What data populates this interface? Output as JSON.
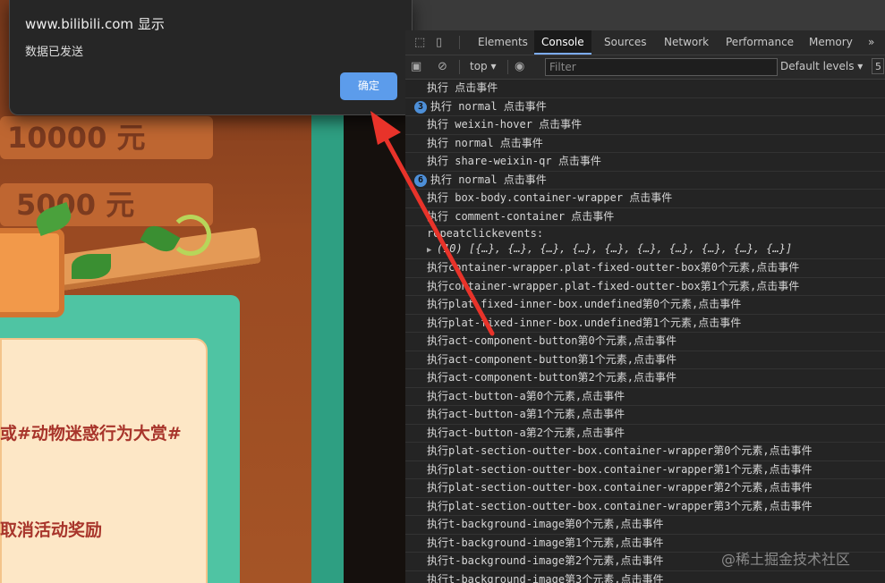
{
  "page": {
    "prizes": [
      "10000 元",
      "5000 元"
    ],
    "text_line1": "或#动物迷惑行为大赏#",
    "text_line2": "取消活动奖励"
  },
  "dialog": {
    "title": "www.bilibili.com 显示",
    "message": "数据已发送",
    "ok_label": "确定"
  },
  "devtools": {
    "tabs": [
      "Elements",
      "Console",
      "Sources",
      "Network",
      "Performance",
      "Memory"
    ],
    "active_tab": "Console",
    "more_tabs": "»",
    "context": "top ▾",
    "filter_placeholder": "Filter",
    "levels": "Default levels ▾",
    "extra": "5",
    "accent": "#7cacf8"
  },
  "console": {
    "rows": [
      {
        "count": "",
        "text": "执行      点击事件"
      },
      {
        "count": "3",
        "text": "执行 normal 点击事件"
      },
      {
        "count": "",
        "text": "执行 weixin-hover 点击事件"
      },
      {
        "count": "",
        "text": "执行 normal 点击事件"
      },
      {
        "count": "",
        "text": "执行 share-weixin-qr 点击事件"
      },
      {
        "count": "6",
        "text": "执行 normal 点击事件"
      },
      {
        "count": "",
        "text": "执行 box-body.container-wrapper 点击事件"
      },
      {
        "count": "",
        "text": "执行 comment-container 点击事件"
      }
    ],
    "object_label": "repeatclickevents:",
    "object_summary": "(10) [{…}, {…}, {…}, {…}, {…}, {…}, {…}, {…}, {…}, {…}]",
    "rows2": [
      "执行container-wrapper.plat-fixed-outter-box第0个元素,点击事件",
      "执行container-wrapper.plat-fixed-outter-box第1个元素,点击事件",
      "执行plat-fixed-inner-box.undefined第0个元素,点击事件",
      "执行plat-fixed-inner-box.undefined第1个元素,点击事件",
      "执行act-component-button第0个元素,点击事件",
      "执行act-component-button第1个元素,点击事件",
      "执行act-component-button第2个元素,点击事件",
      "执行act-button-a第0个元素,点击事件",
      "执行act-button-a第1个元素,点击事件",
      "执行act-button-a第2个元素,点击事件",
      "执行plat-section-outter-box.container-wrapper第0个元素,点击事件",
      "执行plat-section-outter-box.container-wrapper第1个元素,点击事件",
      "执行plat-section-outter-box.container-wrapper第2个元素,点击事件",
      "执行plat-section-outter-box.container-wrapper第3个元素,点击事件",
      "执行t-background-image第0个元素,点击事件",
      "执行t-background-image第1个元素,点击事件",
      "执行t-background-image第2个元素,点击事件",
      "执行t-background-image第3个元素,点击事件"
    ]
  },
  "watermark": "@稀土掘金技术社区",
  "arrow_color": "#e8332a"
}
